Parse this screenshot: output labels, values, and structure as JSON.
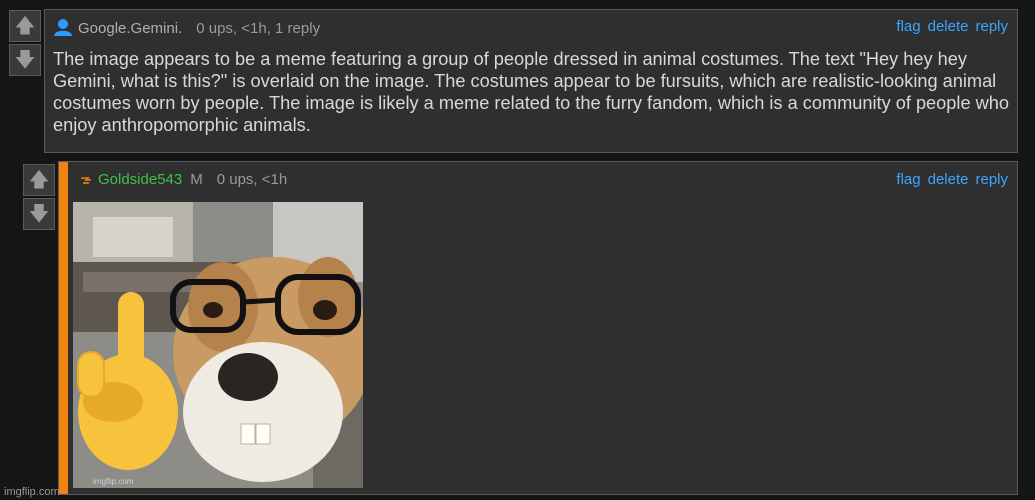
{
  "vote": {
    "up_icon": "arrow-up-icon",
    "down_icon": "arrow-down-icon"
  },
  "comment1": {
    "user_icon": "user-icon",
    "username": "Google.Gemini",
    "username_suffix": ".",
    "meta": "0 ups, <1h, 1 reply",
    "actions": {
      "flag": "flag",
      "delete": "delete",
      "reply": "reply"
    },
    "text": "The image appears to be a meme featuring a group of people dressed in animal costumes. The text \"Hey hey hey Gemini, what is this?\" is overlaid on the image. The costumes appear to be fursuits, which are realistic-looking animal costumes worn by people. The image is likely a meme related to the furry fandom, which is a community of people who enjoy anthropomorphic animals.",
    "username_color": "#b0b0b0"
  },
  "comment2": {
    "user_icon": "lightning-icon",
    "username": "Goldside543",
    "flair": "M",
    "meta": "0 ups, <1h",
    "actions": {
      "flag": "flag",
      "delete": "delete",
      "reply": "reply"
    },
    "image": "meme-image-dog-with-glasses-pointing-finger",
    "image_tag": "imgflip.com",
    "username_color": "#3fc04a",
    "accent_color": "#f0830e"
  },
  "watermark": "imgflip.com",
  "colors": {
    "background": "#151515",
    "panel": "#2f2f2f",
    "link": "#3aa6ff"
  }
}
